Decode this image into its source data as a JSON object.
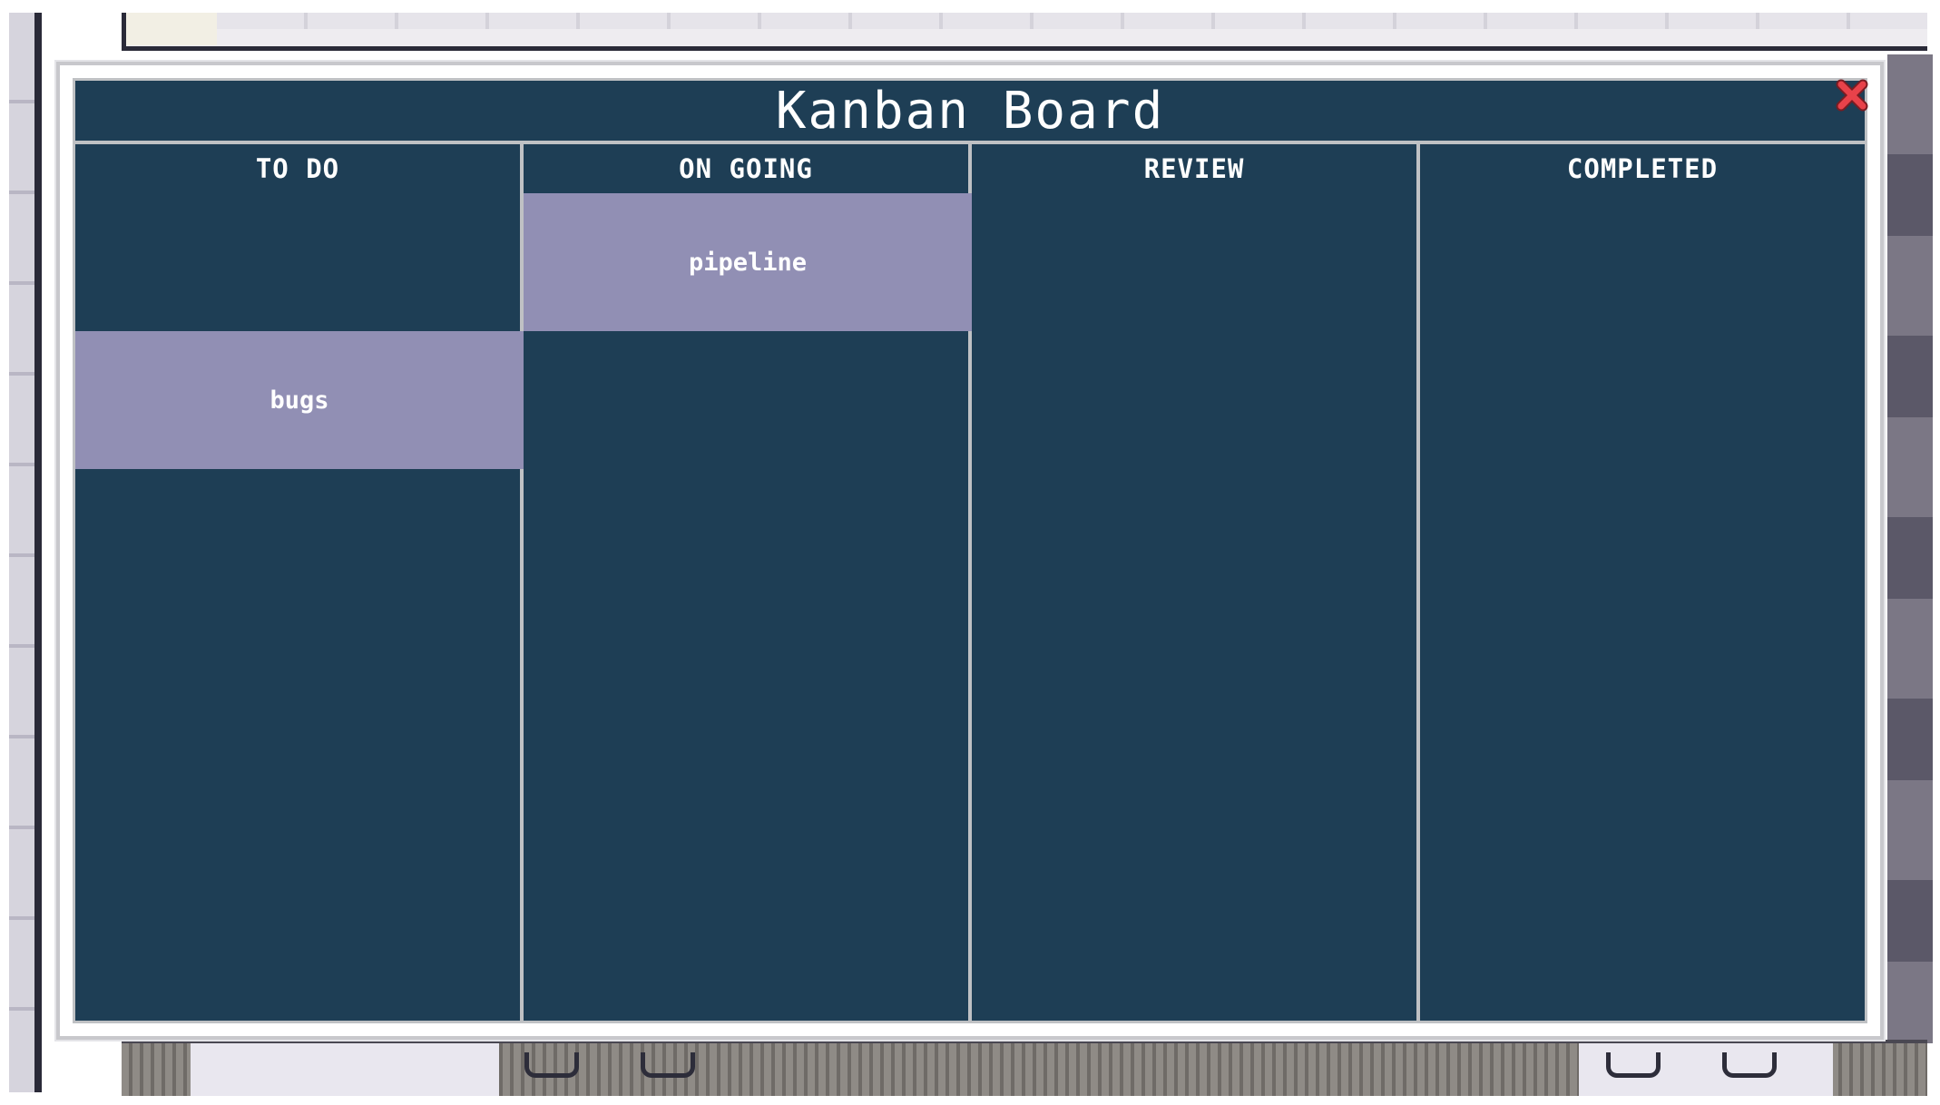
{
  "board": {
    "title": "Kanban Board",
    "close_icon": "close-x-icon",
    "columns": [
      {
        "header": "TO DO"
      },
      {
        "header": "ON GOING"
      },
      {
        "header": "REVIEW"
      },
      {
        "header": "COMPLETED"
      }
    ],
    "cards": [
      {
        "label": "bugs",
        "column": "TO DO"
      },
      {
        "label": "pipeline",
        "column": "ON GOING"
      }
    ]
  },
  "colors": {
    "board_background": "#1e3e55",
    "card_background": "#918fb4",
    "divider": "#bfc1c4",
    "close_icon": "#e8424a"
  }
}
